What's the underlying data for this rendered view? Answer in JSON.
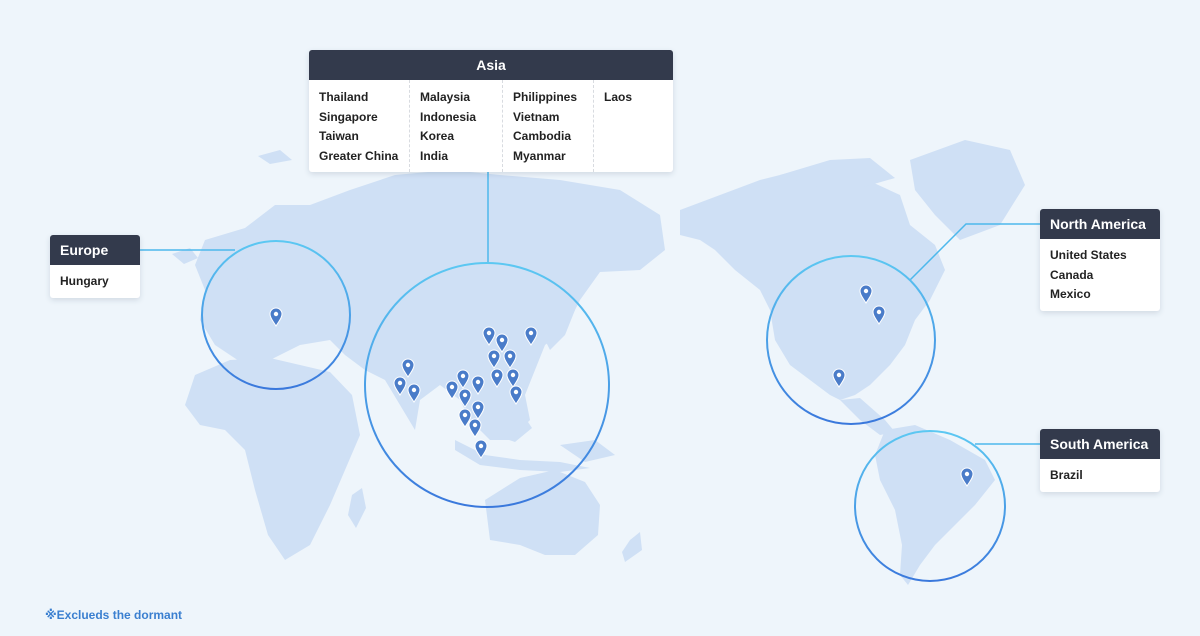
{
  "regions": {
    "asia": {
      "title": "Asia",
      "columns": [
        [
          "Thailand",
          "Singapore",
          "Taiwan",
          "Greater China"
        ],
        [
          "Malaysia",
          "Indonesia",
          "Korea",
          "India"
        ],
        [
          "Philippines",
          "Vietnam",
          "Cambodia",
          "Myanmar"
        ],
        [
          "Laos"
        ]
      ]
    },
    "europe": {
      "title": "Europe",
      "countries": [
        "Hungary"
      ]
    },
    "north_america": {
      "title": "North America",
      "countries": [
        "United States",
        "Canada",
        "Mexico"
      ]
    },
    "south_america": {
      "title": "South America",
      "countries": [
        "Brazil"
      ]
    }
  },
  "footnote": "※Exclueds the dormant",
  "colors": {
    "land": "#cfe0f5",
    "ocean": "#eef5fb",
    "pin": "#4a7cc9",
    "header": "#333a4c",
    "ring": "#3ea0e8"
  },
  "icons": {
    "pin": "location-pin-icon"
  }
}
